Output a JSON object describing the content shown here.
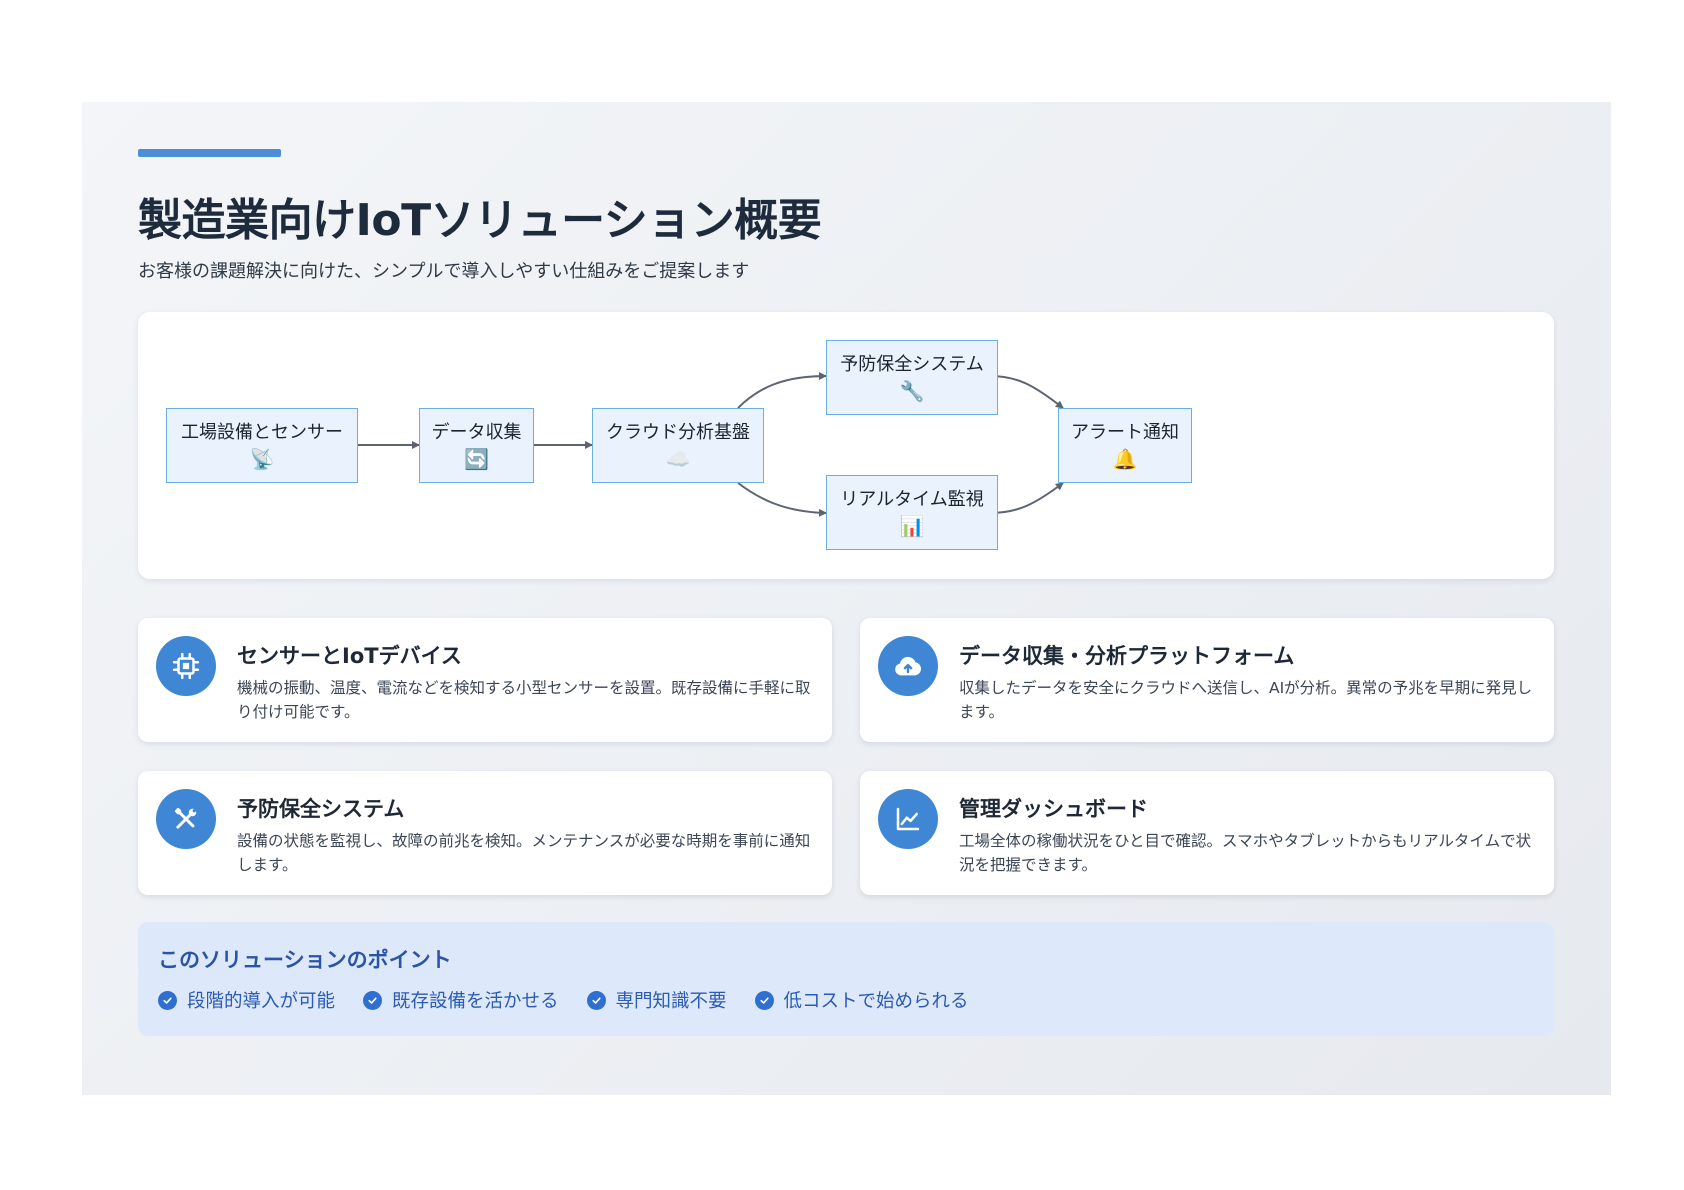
{
  "header": {
    "title": "製造業向けIoTソリューション概要",
    "subtitle": "お客様の課題解決に向けた、シンプルで導入しやすい仕組みをご提案します"
  },
  "diagram": {
    "nodes": [
      {
        "id": "factory",
        "label": "工場設備とセンサー",
        "icon": "📡"
      },
      {
        "id": "collect",
        "label": "データ収集",
        "icon": "🔄"
      },
      {
        "id": "cloud",
        "label": "クラウド分析基盤",
        "icon": "☁️"
      },
      {
        "id": "maintenance",
        "label": "予防保全システム",
        "icon": "🔧"
      },
      {
        "id": "monitor",
        "label": "リアルタイム監視",
        "icon": "📊"
      },
      {
        "id": "alert",
        "label": "アラート通知",
        "icon": "🔔"
      }
    ],
    "edges": [
      {
        "from": "factory",
        "to": "collect"
      },
      {
        "from": "collect",
        "to": "cloud"
      },
      {
        "from": "cloud",
        "to": "maintenance"
      },
      {
        "from": "cloud",
        "to": "monitor"
      },
      {
        "from": "maintenance",
        "to": "alert"
      },
      {
        "from": "monitor",
        "to": "alert"
      }
    ]
  },
  "cards": [
    {
      "title": "センサーとIoTデバイス",
      "description": "機械の振動、温度、電流などを検知する小型センサーを設置。既存設備に手軽に取り付け可能です。",
      "icon": "chip-icon"
    },
    {
      "title": "データ収集・分析プラットフォーム",
      "description": "収集したデータを安全にクラウドへ送信し、AIが分析。異常の予兆を早期に発見します。",
      "icon": "cloud-upload-icon"
    },
    {
      "title": "予防保全システム",
      "description": "設備の状態を監視し、故障の前兆を検知。メンテナンスが必要な時期を事前に通知します。",
      "icon": "tools-icon"
    },
    {
      "title": "管理ダッシュボード",
      "description": "工場全体の稼働状況をひと目で確認。スマホやタブレットからもリアルタイムで状況を把握できます。",
      "icon": "chart-line-icon"
    }
  ],
  "points": {
    "title": "このソリューションのポイント",
    "items": [
      "段階的導入が可能",
      "既存設備を活かせる",
      "専門知識不要",
      "低コストで始められる"
    ]
  },
  "colors": {
    "accent": "#4a8fd8",
    "icon_bg": "#3f86d4",
    "node_fill": "#e9f2fd",
    "node_border": "#6aaee8",
    "points_bg": "#dde9fb",
    "points_text": "#2c5bb3"
  }
}
